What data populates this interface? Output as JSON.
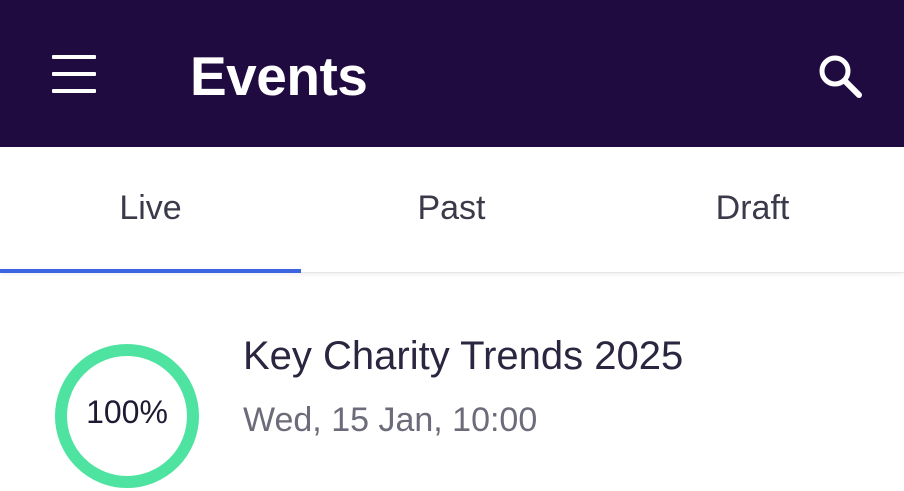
{
  "header": {
    "title": "Events",
    "menu_icon": "hamburger-menu-icon",
    "search_icon": "search-icon"
  },
  "tabs": [
    {
      "label": "Live",
      "selected": true
    },
    {
      "label": "Past",
      "selected": false
    },
    {
      "label": "Draft",
      "selected": false
    }
  ],
  "events": [
    {
      "title": "Key Charity Trends 2025",
      "date": "Wed, 15 Jan, 10:00",
      "progress_label": "100%",
      "progress": 1.0
    }
  ],
  "colors": {
    "header_bg": "#200b40",
    "tab_indicator": "#3d64e0",
    "progress_ring": "#4ee3a0"
  }
}
